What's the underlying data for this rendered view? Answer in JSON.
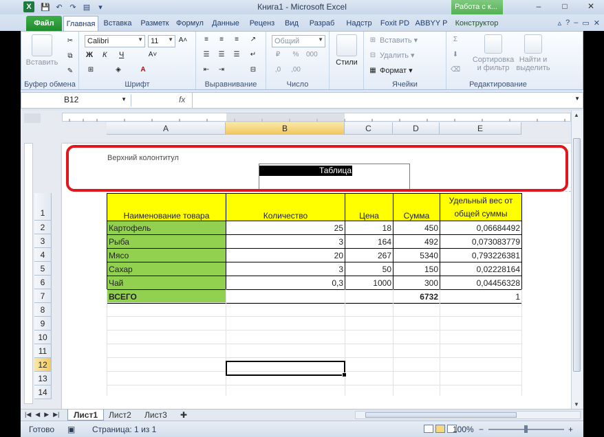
{
  "window": {
    "title": "Книга1  -  Microsoft Excel",
    "context_tab": "Работа с к...",
    "controls": [
      "–",
      "□",
      "✕"
    ]
  },
  "tabs": [
    "Файл",
    "Главная",
    "Вставка",
    "Разметк",
    "Формул",
    "Данные",
    "Реценз",
    "Вид",
    "Разраб",
    "Надстр",
    "Foxit PD",
    "ABBYY P",
    "Конструктор"
  ],
  "ribbon": {
    "clipboard": {
      "paste": "Вставить",
      "label": "Буфер обмена"
    },
    "font": {
      "name": "Calibri",
      "size": "11",
      "bold": "Ж",
      "italic": "К",
      "underline": "Ч",
      "label": "Шрифт"
    },
    "alignment": {
      "label": "Выравнивание"
    },
    "number": {
      "format": "Общий",
      "label": "Число"
    },
    "styles": {
      "label": "Стили"
    },
    "cells": {
      "insert": "Вставить",
      "delete": "Удалить",
      "format": "Формат",
      "label": "Ячейки"
    },
    "editing": {
      "sort": "Сортировка и фильтр",
      "find": "Найти и выделить",
      "label": "Редактирование"
    }
  },
  "formula_bar": {
    "name_box": "B12",
    "fx": "fx",
    "value": ""
  },
  "columns": [
    "A",
    "B",
    "C",
    "D",
    "E"
  ],
  "header": {
    "label": "Верхний колонтитул",
    "text": "Таблица"
  },
  "table": {
    "headers": [
      "Наименование товара",
      "Количество",
      "Цена",
      "Сумма",
      "Удельный вес от общей суммы"
    ],
    "rows": [
      [
        "Картофель",
        "25",
        "18",
        "450",
        "0,06684492"
      ],
      [
        "Рыба",
        "3",
        "164",
        "492",
        "0,073083779"
      ],
      [
        "Мясо",
        "20",
        "267",
        "5340",
        "0,793226381"
      ],
      [
        "Сахар",
        "3",
        "50",
        "150",
        "0,02228164"
      ],
      [
        "Чай",
        "0,3",
        "1000",
        "300",
        "0,04456328"
      ]
    ],
    "total": [
      "ВСЕГО",
      "",
      "",
      "6732",
      "1"
    ]
  },
  "row_numbers": [
    "1",
    "2",
    "3",
    "4",
    "5",
    "6",
    "7",
    "8",
    "9",
    "10",
    "11",
    "12",
    "13",
    "14"
  ],
  "selected_cell": "B12",
  "sheets": [
    "Лист1",
    "Лист2",
    "Лист3"
  ],
  "status": {
    "ready": "Готово",
    "page": "Страница: 1 из 1",
    "zoom": "100%"
  }
}
